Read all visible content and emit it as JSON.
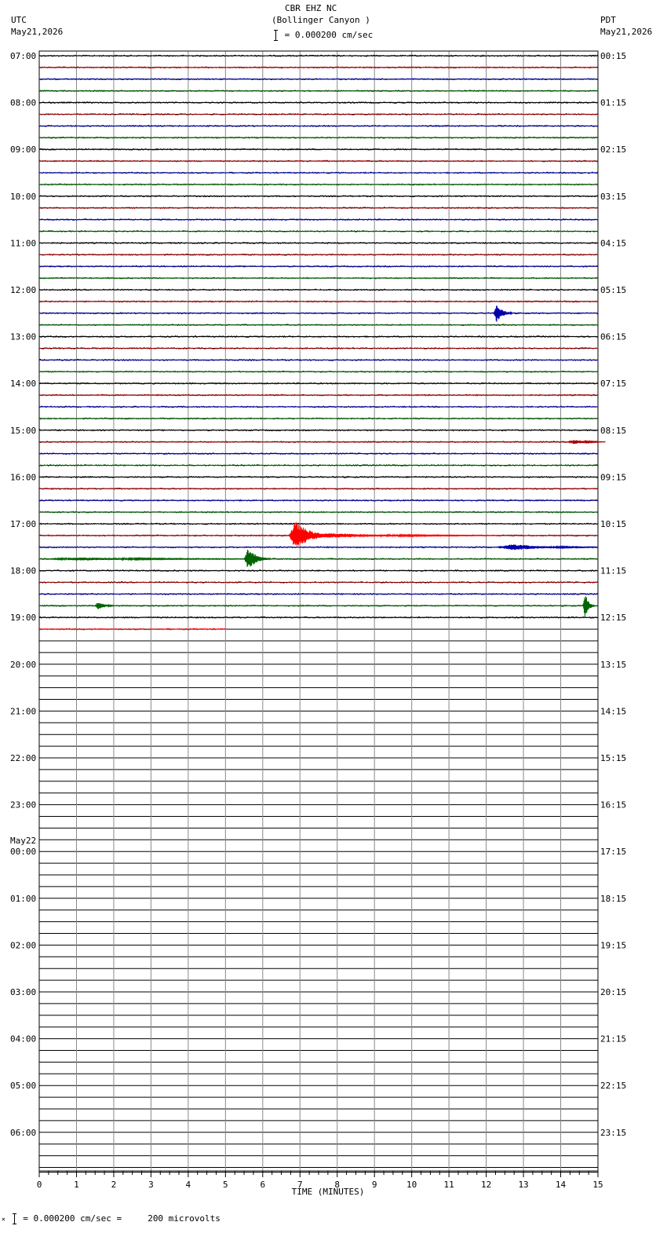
{
  "header": {
    "station_line": "CBR EHZ NC",
    "location_line": "(Bollinger Canyon )",
    "scale_text": "= 0.000200 cm/sec",
    "left_tz": "UTC",
    "left_date": "May21,2026",
    "right_tz": "PDT",
    "right_date": "May21,2026"
  },
  "footer": {
    "scale_text": "= 0.000200 cm/sec =     200 microvolts"
  },
  "chart_data": {
    "type": "line",
    "title": "CBR EHZ NC (Bollinger Canyon )",
    "xlabel": "TIME (MINUTES)",
    "xlim": [
      0,
      15
    ],
    "x_ticks": [
      "0",
      "1",
      "2",
      "3",
      "4",
      "5",
      "6",
      "7",
      "8",
      "9",
      "10",
      "11",
      "12",
      "13",
      "14",
      "15"
    ],
    "rows_per_hour": 4,
    "total_rows": 96,
    "left_hour_labels": [
      "07:00",
      "08:00",
      "09:00",
      "10:00",
      "11:00",
      "12:00",
      "13:00",
      "14:00",
      "15:00",
      "16:00",
      "17:00",
      "18:00",
      "19:00",
      "20:00",
      "21:00",
      "22:00",
      "23:00",
      "00:00",
      "01:00",
      "02:00",
      "03:00",
      "04:00",
      "05:00",
      "06:00"
    ],
    "left_date_change": "May22",
    "right_hour_labels": [
      "00:15",
      "01:15",
      "02:15",
      "03:15",
      "04:15",
      "05:15",
      "06:15",
      "07:15",
      "08:15",
      "09:15",
      "10:15",
      "11:15",
      "12:15",
      "13:15",
      "14:15",
      "15:15",
      "16:15",
      "17:15",
      "18:15",
      "19:15",
      "20:15",
      "21:15",
      "22:15",
      "23:15"
    ],
    "trace_colors": [
      "#000000",
      "#aa0000",
      "#0000aa",
      "#006400"
    ],
    "highlight_color": "#ff0000",
    "filled_rows": 50,
    "last_row_end_minute": 5.0,
    "events": [
      {
        "row": 22,
        "minute": 12.2,
        "duration": 0.5,
        "amplitude": 12
      },
      {
        "row": 33,
        "minute": 14.2,
        "duration": 1.0,
        "amplitude": 3
      },
      {
        "row": 41,
        "minute": 6.7,
        "duration": 1.2,
        "amplitude": 18,
        "color": "#ff0000"
      },
      {
        "row": 41,
        "minute": 7.0,
        "duration": 5.3,
        "amplitude": 3,
        "color": "#ff0000"
      },
      {
        "row": 42,
        "minute": 12.3,
        "duration": 2.7,
        "amplitude": 4
      },
      {
        "row": 43,
        "minute": 0.2,
        "duration": 6.0,
        "amplitude": 2
      },
      {
        "row": 43,
        "minute": 5.5,
        "duration": 0.7,
        "amplitude": 14
      },
      {
        "row": 47,
        "minute": 1.5,
        "duration": 0.5,
        "amplitude": 6
      },
      {
        "row": 47,
        "minute": 14.6,
        "duration": 0.3,
        "amplitude": 18
      }
    ]
  }
}
